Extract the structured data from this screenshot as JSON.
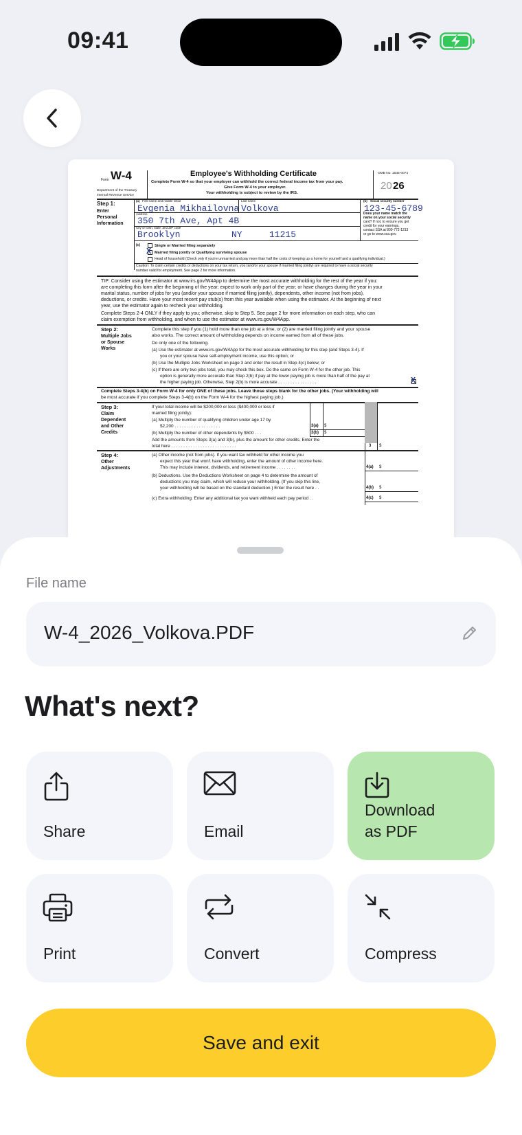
{
  "status_bar": {
    "time": "09:41"
  },
  "document": {
    "form_prefix": "Form",
    "form_name": "W-4",
    "dept": "Department of the Treasury",
    "irs": "Internal Revenue Service",
    "title": "Employee's Withholding Certificate",
    "sub1": "Complete Form W-4 so that your employer can withhold the correct federal income tax from your pay.",
    "sub2": "Give Form W-4 to your employer.",
    "sub3": "Your withholding is subject to review by the IRS.",
    "omb": "OMB No. 1545-0074",
    "year_prefix": "20",
    "year_suffix": "26",
    "step1_title": "Step 1:",
    "step1_l1": "Enter",
    "step1_l2": "Personal",
    "step1_l3": "Information",
    "lbl_a": "(a)",
    "lbl_first": "First name and middle initial",
    "lbl_last": "Last name",
    "lbl_b": "(b)",
    "lbl_ssn": "Social security number",
    "first_name": "Evgenia   Mikhailovna",
    "last_name": "Volkova",
    "ssn": "123-45-6789",
    "lbl_address": "Address",
    "address": "350 7th Ave, Apt 4B",
    "lbl_city": "City or town, state, and ZIP code",
    "city": "Brooklyn",
    "state": "NY",
    "zip": "11215",
    "name_match_1": "Does your name match the",
    "name_match_2": "name on your social security",
    "name_match_3": "card? If not, to ensure you get",
    "name_match_4": "credit for your earnings,",
    "name_match_5": "contact SSA at 800-772-1213",
    "name_match_6": "or go to www.ssa.gov.",
    "lbl_c": "(c)",
    "opt_single": "Single or Married filing separately",
    "opt_married": "Married filing jointly or Qualifying surviving spouse",
    "opt_hoh": "Head of household (Check only if you're unmarried and pay more than half the costs of keeping up a home for yourself and a qualifying individual.)",
    "check_mark": "X",
    "caution_1": "Caution: To claim certain credits or deductions on your tax return, you (and/or your spouse if married filing jointly) are required to have a social security",
    "caution_2": "number valid for employment. See page 2 for more information.",
    "tip_1": "TIP: Consider using the estimator at www.irs.gov/W4App to determine the most accurate withholding for the rest of the year if you:",
    "tip_2": "are completing this form after the beginning of the year; expect to work only part of the year; or have changes during the year in your",
    "tip_3": "marital status, number of jobs for you (and/or your spouse if married filing jointly), dependents, other income (not from jobs),",
    "tip_4": "deductions, or credits. Have your most recent pay stub(s) from this year available when using the estimator. At the beginning of next",
    "tip_5": "year, use the estimator again to recheck your withholding.",
    "steps_1": "Complete Steps 2-4 ONLY if they apply to you; otherwise, skip to Step 5. See page 2 for more information on each step, who can",
    "steps_2": "claim exemption from withholding, and when to use the estimator at www.irs.gov/W4App.",
    "step2_title": "Step 2:",
    "step2_l1": "Multiple Jobs",
    "step2_l2": "or Spouse",
    "step2_l3": "Works",
    "s2_1": "Complete this step if you (1) hold more than one job at a time, or (2) are married filing jointly and your spouse",
    "s2_2": "also works. The correct amount of withholding depends on income earned from all of these jobs.",
    "s2_3": "Do only one of the following.",
    "s2_a1": "(a) Use the estimator at www.irs.gov/W4App for the most accurate withholding for this step (and Steps 3-4). If",
    "s2_a2": "you or your spouse have self-employment income, use this option; or",
    "s2_b": "(b) Use the Multiple Jobs Worksheet on page 3 and enter the result in Step 4(c) below; or",
    "s2_c1": "(c) If there are only two jobs total, you may check this box. Do the same on Form W-4 for the other job. This",
    "s2_c2": "option is generally more accurate than Step 2(b) if pay at the lower paying job is more than half of the pay at",
    "s2_c3": "the higher paying job. Otherwise, Step 2(b) is more accurate  .  .  .  .  .  .  .  .  .  .  .  .  .  .  .  .",
    "s34_1": "Complete Steps 3-4(b) on Form W-4 for only ONE of these jobs. Leave those steps blank for the other jobs. (Your withholding will",
    "s34_2": "be most accurate if you complete Steps 3-4(b) on the Form W-4 for the highest paying job.)",
    "step3_title": "Step 3:",
    "step3_l1": "Claim",
    "step3_l2": "Dependent",
    "step3_l3": "and Other",
    "step3_l4": "Credits",
    "s3_1": "If your total income will be $200,000 or less ($400,000 or less if",
    "s3_2": "married filing jointly):",
    "s3_a1": "(a) Multiply the number of qualifying children under age 17 by",
    "s3_a2": "$2,200  .  .  .  .  .  .  .  .  .  .  .  .  .  .  .  .  .  .  .",
    "s3_b": "(b) Multiply the number of other dependents by $500  .  .  .",
    "s3_add1": "Add the amounts from Steps 3(a) and 3(b), plus the amount for other credits. Enter the",
    "s3_add2": "total here  .  .  .  .  .  .  .  .  .  .  .  .  .  .  .  .  .  .  .  .  .  .  .  .  .  .  .",
    "box_3a": "3(a)",
    "box_3b": "3(b)",
    "box_3": "3",
    "dollar": "$",
    "step4_title": "Step 4:",
    "step4_l1": "Other",
    "step4_l2": "Adjustments",
    "s4_a1": "(a) Other income (not from jobs). If you want tax withheld for other income you",
    "s4_a2": "expect this year that won't have withholding, enter the amount of other income here.",
    "s4_a3": "This may include interest, dividends, and retirement income  .  .  .  .  .  .  .  .",
    "s4_b1": "(b) Deductions. Use the Deductions Worksheet on page 4 to determine the amount of",
    "s4_b2": "deductions you may claim, which will reduce your withholding. (If you skip this line,",
    "s4_b3": "your withholding will be based on the standard deduction.) Enter the result here  .  .",
    "s4_c": "(c) Extra withholding. Enter any additional tax you want withheld each pay period  .  .",
    "box_4a": "4(a)",
    "box_4b": "4(b)",
    "box_4c": "4(c)"
  },
  "sheet": {
    "file_name_label": "File name",
    "file_name_value": "W-4_2026_Volkova.PDF",
    "heading": "What's next?",
    "actions": [
      {
        "label": "Share",
        "icon": "share-icon"
      },
      {
        "label": "Email",
        "icon": "mail-icon"
      },
      {
        "label": "Download\nas PDF",
        "icon": "download-icon"
      },
      {
        "label": "Print",
        "icon": "printer-icon"
      },
      {
        "label": "Convert",
        "icon": "convert-icon"
      },
      {
        "label": "Compress",
        "icon": "compress-icon"
      }
    ],
    "save_label": "Save and exit"
  },
  "colors": {
    "background": "#eff0f5",
    "tile": "#f4f5fa",
    "accent_green": "#b7e7ae",
    "accent_yellow": "#fccd2b",
    "battery_green": "#34c759",
    "form_fill_ink": "#2a3d8f"
  }
}
